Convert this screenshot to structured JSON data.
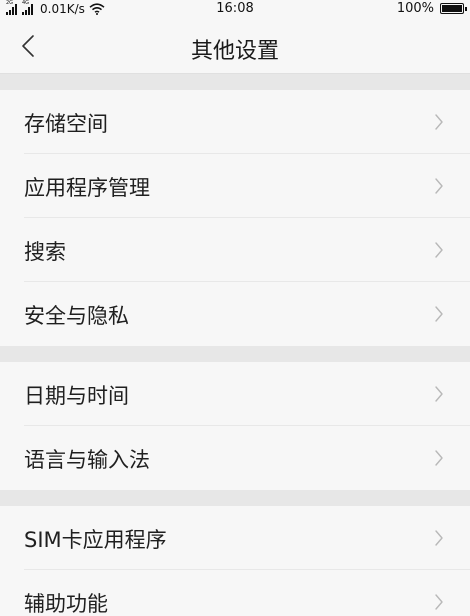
{
  "status_bar": {
    "signal1_tag": "2G",
    "signal2_tag": "4G",
    "network_speed": "0.01K/s",
    "time": "16:08",
    "battery": "100%"
  },
  "header": {
    "title": "其他设置"
  },
  "groups": [
    {
      "items": [
        {
          "label": "存储空间"
        },
        {
          "label": "应用程序管理"
        },
        {
          "label": "搜索"
        },
        {
          "label": "安全与隐私"
        }
      ]
    },
    {
      "items": [
        {
          "label": "日期与时间"
        },
        {
          "label": "语言与输入法"
        }
      ]
    },
    {
      "items": [
        {
          "label": "SIM卡应用程序"
        },
        {
          "label": "辅助功能"
        }
      ]
    }
  ],
  "icons": {
    "back": "chevron-left-icon",
    "item_arrow": "chevron-right-icon",
    "wifi": "wifi-icon",
    "battery": "battery-icon"
  },
  "colors": {
    "background": "#f7f7f7",
    "separator": "#e7e7e7",
    "text": "#1f1f1f",
    "chevron": "#b8b8b8"
  }
}
